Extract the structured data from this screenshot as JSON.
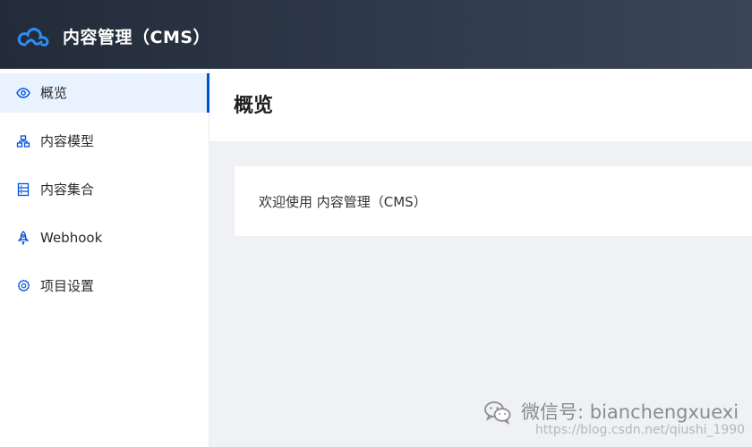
{
  "header": {
    "app_title": "内容管理（CMS）",
    "logo_icon": "cloud-logo-icon"
  },
  "sidebar": {
    "items": [
      {
        "label": "概览",
        "icon": "eye-icon",
        "active": true
      },
      {
        "label": "内容模型",
        "icon": "model-tree-icon",
        "active": false
      },
      {
        "label": "内容集合",
        "icon": "collection-icon",
        "active": false
      },
      {
        "label": "Webhook",
        "icon": "rocket-icon",
        "active": false
      },
      {
        "label": "项目设置",
        "icon": "gear-icon",
        "active": false
      }
    ]
  },
  "main": {
    "page_title": "概览",
    "welcome_text": "欢迎使用 内容管理（CMS）"
  },
  "watermarks": {
    "wechat_text": "微信号: bianchengxuexi",
    "url_text": "https://blog.csdn.net/qiushi_1990"
  },
  "colors": {
    "accent": "#0052d9",
    "header_bg": "#2a3444",
    "active_item_bg": "#e8f3ff",
    "content_bg": "#eff1f4"
  }
}
